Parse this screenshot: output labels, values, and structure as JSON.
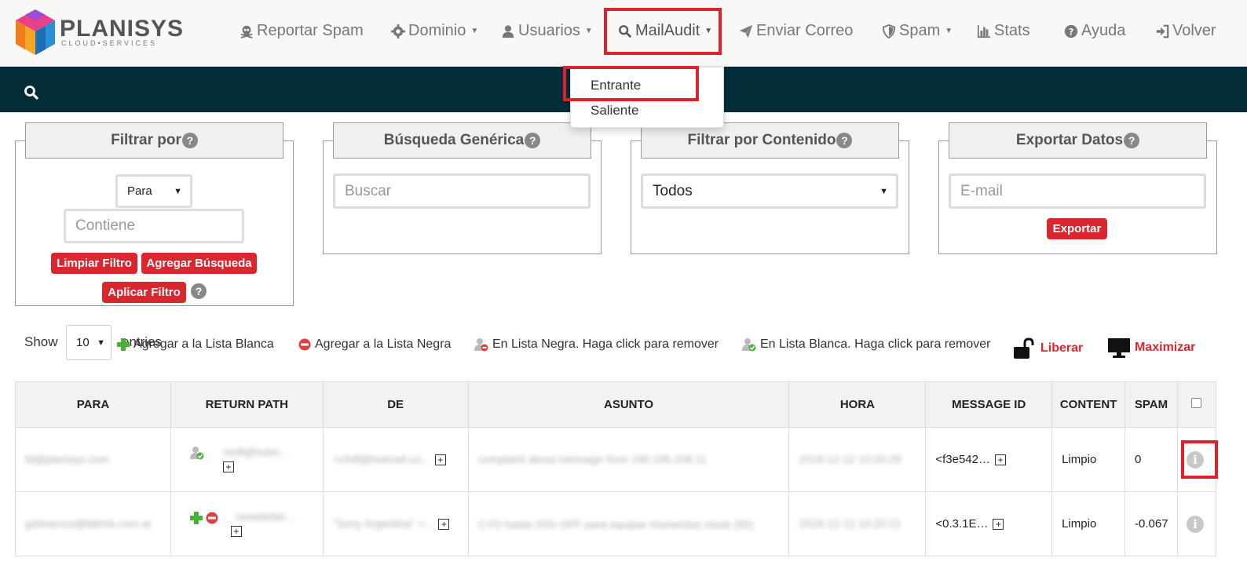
{
  "brand": {
    "name": "PLANISYS",
    "tagline": "CLOUD•SERVICES"
  },
  "nav": {
    "report_spam": "Reportar Spam",
    "domain": "Dominio",
    "users": "Usuarios",
    "mailaudit": "MailAudit",
    "send_mail": "Enviar Correo",
    "spam": "Spam",
    "stats": "Stats",
    "help": "Ayuda",
    "back": "Volver"
  },
  "mailaudit_menu": {
    "incoming": "Entrante",
    "outgoing": "Saliente"
  },
  "filter_panel": {
    "title": "Filtrar por",
    "field_select": "Para",
    "contains_placeholder": "Contiene",
    "clear_btn": "Limpiar Filtro",
    "add_search_btn": "Agregar Búsqueda",
    "apply_btn": "Aplicar Filtro"
  },
  "generic_search": {
    "title": "Búsqueda Genérica",
    "placeholder": "Buscar"
  },
  "content_filter": {
    "title": "Filtrar por Contenido",
    "selected": "Todos"
  },
  "export": {
    "title": "Exportar Datos",
    "placeholder": "E-mail",
    "button": "Exportar"
  },
  "list_controls": {
    "show": "Show",
    "page_size": "10",
    "entries": "entries"
  },
  "legend": {
    "add_white": "Agregar a la Lista Blanca",
    "add_black": "Agregar a la Lista Negra",
    "in_black": "En Lista Negra. Haga click para remover",
    "in_white": "En Lista Blanca. Haga click para remover",
    "release": "Liberar",
    "maximize": "Maximizar"
  },
  "table": {
    "columns": [
      "PARA",
      "RETURN PATH",
      "DE",
      "ASUNTO",
      "HORA",
      "MESSAGE ID",
      "CONTENT",
      "SPAM"
    ],
    "rows": [
      {
        "para": "fd@planisys.com",
        "return_path": "ctoff@hotm...",
        "de": "<cfoff@hotmail.co...",
        "asunto": "complaint about message from 190.195.108.11",
        "hora": "2018-12-12 10:20:28",
        "message_id": "<f3e542…",
        "content": "Limpio",
        "spam": "0"
      },
      {
        "para": "gsimarcos@bitmls.com.ar",
        "return_path": "newsletter...",
        "de": "\"Sony Argentina\" <...",
        "asunto": "CYO hasta 20% OFF para equipar momentos mesé (50)",
        "hora": "2018-12-12 10:20:21",
        "message_id": "<0.3.1E…",
        "content": "Limpio",
        "spam": "-0.067"
      }
    ]
  },
  "colors": {
    "accent_red": "#d9262f",
    "dark_bar": "#022d38",
    "highlight": "#e0202a"
  }
}
